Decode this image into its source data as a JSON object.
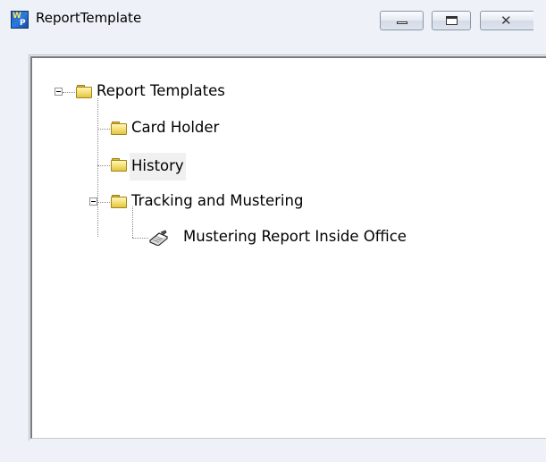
{
  "window": {
    "title": "ReportTemplate",
    "icon": "report-template-app-icon",
    "buttons": {
      "minimize": "minimize-icon",
      "maximize": "maximize-icon",
      "close": "close-icon"
    }
  },
  "tree": {
    "root": {
      "label": "Report Templates",
      "expanded": true,
      "icon": "folder-icon"
    },
    "children": [
      {
        "label": "Card Holder",
        "icon": "folder-icon"
      },
      {
        "label": "History",
        "icon": "folder-icon",
        "hovered": true
      },
      {
        "label": "Tracking and Mustering",
        "icon": "folder-icon",
        "expanded": true,
        "children": [
          {
            "label": "Mustering Report Inside Office",
            "icon": "report-icon"
          }
        ]
      }
    ]
  },
  "colors": {
    "window_bg": "#eef2f8",
    "folder": "#f3de6e",
    "hover": "#f0f0f0"
  }
}
